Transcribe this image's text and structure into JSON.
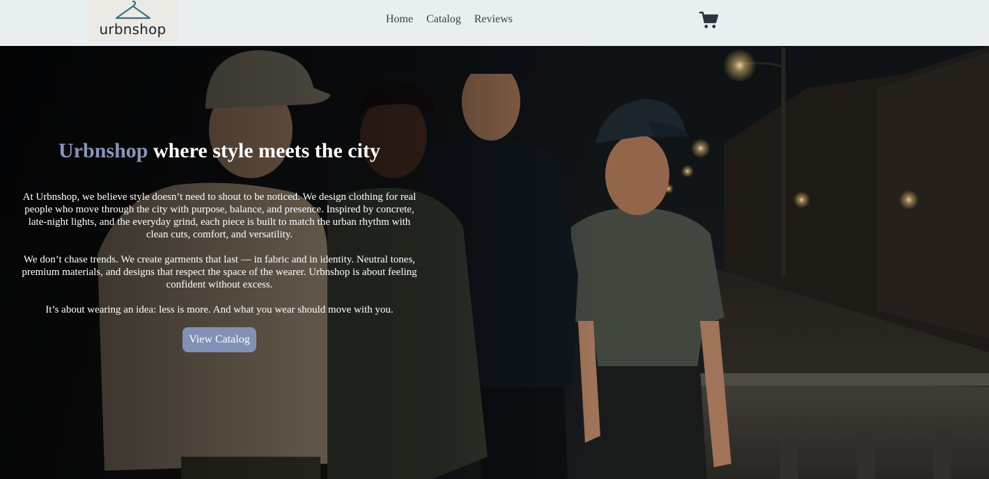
{
  "header": {
    "logo_text": "urbnshop",
    "logo_icon": "hanger-icon",
    "nav": [
      {
        "label": "Home"
      },
      {
        "label": "Catalog"
      },
      {
        "label": "Reviews"
      }
    ],
    "cart_icon": "shopping-cart-icon"
  },
  "hero": {
    "headline_brand": "Urbnshop",
    "headline_rest": " where style meets the city",
    "paragraphs": [
      "At Urbnshop, we believe style doesn’t need to shout to be noticed. We design clothing for real people who move through the city with purpose, balance, and presence. Inspired by concrete, late-night lights, and the everyday grind, each piece is built to match the urban rhythm with clean cuts, comfort, and versatility.",
      "We don’t chase trends. We create garments that last — in fabric and in identity. Neutral tones, premium materials, and designs that respect the space of the wearer. Urbnshop is about feeling confident without excess.",
      "It’s about wearing an idea: less is more. And what you wear should move with you."
    ],
    "cta_label": "View Catalog"
  },
  "colors": {
    "header_bg": "#e9eff0",
    "brand_accent": "#8895b6",
    "button_bg": "#8190b5"
  }
}
